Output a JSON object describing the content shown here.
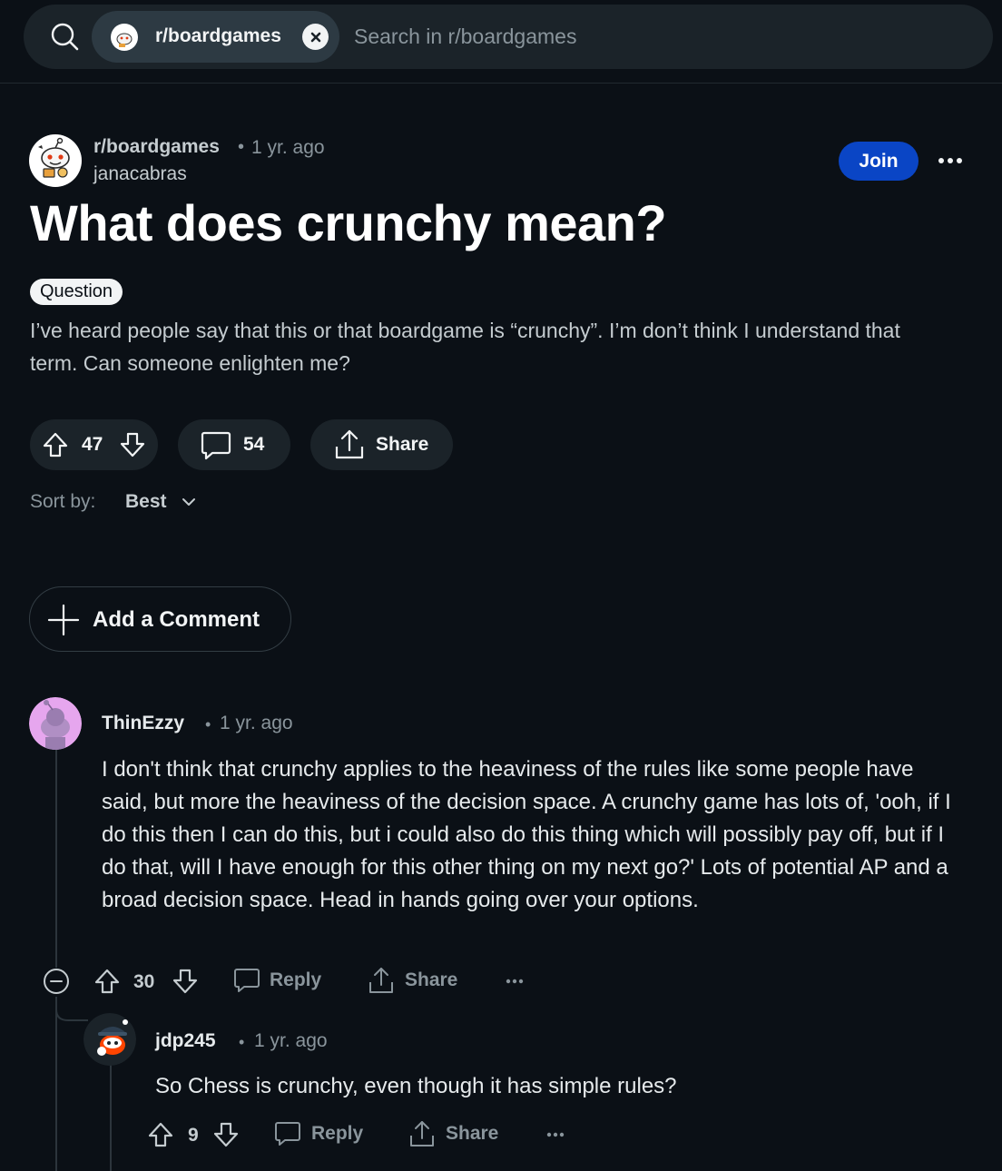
{
  "search": {
    "chip_label": "r/boardgames",
    "placeholder": "Search in r/boardgames"
  },
  "post": {
    "subreddit": "r/boardgames",
    "separator": "•",
    "time": "1 yr. ago",
    "author": "janacabras",
    "join_label": "Join",
    "title": "What does crunchy mean?",
    "flair": "Question",
    "body": "I’ve heard people say that this or that boardgame is “crunchy”. I’m don’t think I understand that term. Can someone enlighten me?",
    "votes": "47",
    "comments": "54",
    "share_label": "Share"
  },
  "sort": {
    "label": "Sort by:",
    "value": "Best"
  },
  "add_comment_label": "Add a Comment",
  "comments": [
    {
      "author": "ThinEzzy",
      "separator": "•",
      "time": "1 yr. ago",
      "body": "I don't think that crunchy applies to the heaviness of the rules like some people have said, but more the heaviness of the decision space. A crunchy game has lots of, 'ooh, if I do this then I can do this, but i could also do this thing which will possibly pay off, but if I do that, will I have enough for this other thing on my next go?' Lots of potential AP and a broad decision space. Head in hands going over your options.",
      "votes": "30",
      "reply_label": "Reply",
      "share_label": "Share"
    },
    {
      "author": "jdp245",
      "separator": "•",
      "time": "1 yr. ago",
      "body": "So Chess is crunchy, even though it has simple rules?",
      "votes": "9",
      "reply_label": "Reply",
      "share_label": "Share"
    }
  ],
  "colors": {
    "background": "#0b1016",
    "join": "#0a45c5",
    "pill": "#1b2329"
  }
}
